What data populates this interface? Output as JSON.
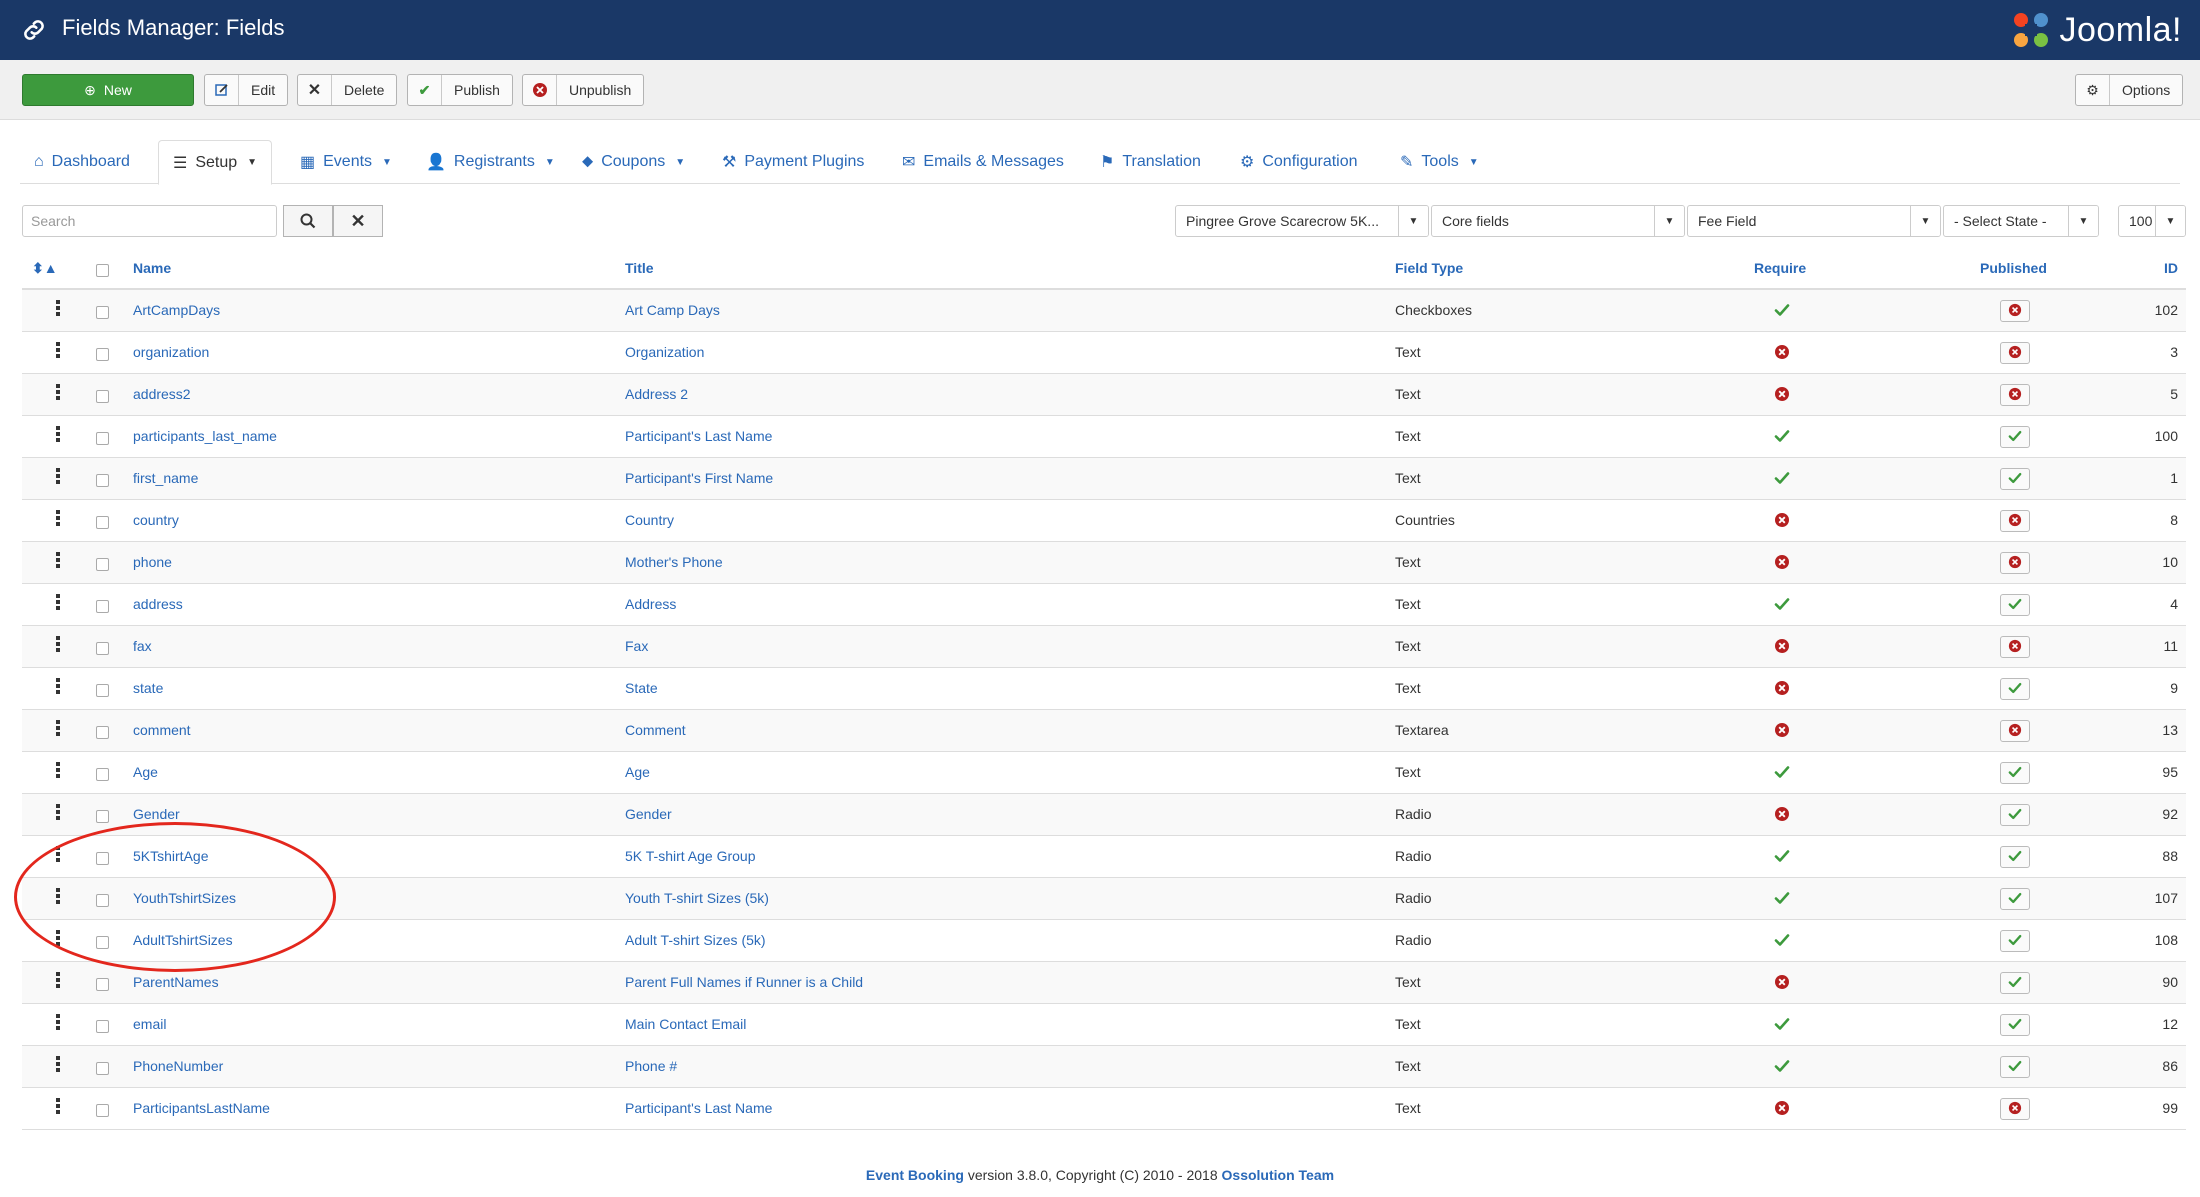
{
  "header": {
    "title": "Fields Manager: Fields",
    "brand": "Joomla!"
  },
  "toolbar": {
    "new": "New",
    "edit": "Edit",
    "delete": "Delete",
    "publish": "Publish",
    "unpublish": "Unpublish",
    "options": "Options"
  },
  "nav": [
    {
      "label": "Dashboard",
      "icon": "home-icon",
      "dropdown": false
    },
    {
      "label": "Setup",
      "icon": "list-icon",
      "dropdown": true,
      "active": true
    },
    {
      "label": "Events",
      "icon": "calendar-icon",
      "dropdown": true
    },
    {
      "label": "Registrants",
      "icon": "user-icon",
      "dropdown": true
    },
    {
      "label": "Coupons",
      "icon": "tag-icon",
      "dropdown": true
    },
    {
      "label": "Payment Plugins",
      "icon": "wrench-icon",
      "dropdown": false
    },
    {
      "label": "Emails & Messages",
      "icon": "mail-icon",
      "dropdown": false
    },
    {
      "label": "Translation",
      "icon": "flag-icon",
      "dropdown": false
    },
    {
      "label": "Configuration",
      "icon": "gear-icon",
      "dropdown": false
    },
    {
      "label": "Tools",
      "icon": "tools-icon",
      "dropdown": true
    }
  ],
  "filters": {
    "search_placeholder": "Search",
    "event": "Pingree Grove Scarecrow 5K...",
    "category": "Core fields",
    "fee": "Fee Field",
    "state": "- Select State -",
    "limit": "100"
  },
  "table": {
    "headers": {
      "name": "Name",
      "title": "Title",
      "type": "Field Type",
      "require": "Require",
      "published": "Published",
      "id": "ID"
    },
    "rows": [
      {
        "name": "ArtCampDays",
        "title": "Art Camp Days",
        "type": "Checkboxes",
        "require": true,
        "published": false,
        "id": "102"
      },
      {
        "name": "organization",
        "title": "Organization",
        "type": "Text",
        "require": false,
        "published": false,
        "id": "3"
      },
      {
        "name": "address2",
        "title": "Address 2",
        "type": "Text",
        "require": false,
        "published": false,
        "id": "5"
      },
      {
        "name": "participants_last_name",
        "title": "Participant's Last Name",
        "type": "Text",
        "require": true,
        "published": true,
        "id": "100"
      },
      {
        "name": "first_name",
        "title": "Participant's First Name",
        "type": "Text",
        "require": true,
        "published": true,
        "id": "1"
      },
      {
        "name": "country",
        "title": "Country",
        "type": "Countries",
        "require": false,
        "published": false,
        "id": "8"
      },
      {
        "name": "phone",
        "title": "Mother's Phone",
        "type": "Text",
        "require": false,
        "published": false,
        "id": "10"
      },
      {
        "name": "address",
        "title": "Address",
        "type": "Text",
        "require": true,
        "published": true,
        "id": "4"
      },
      {
        "name": "fax",
        "title": "Fax",
        "type": "Text",
        "require": false,
        "published": false,
        "id": "11"
      },
      {
        "name": "state",
        "title": "State",
        "type": "Text",
        "require": false,
        "published": true,
        "id": "9"
      },
      {
        "name": "comment",
        "title": "Comment",
        "type": "Textarea",
        "require": false,
        "published": false,
        "id": "13"
      },
      {
        "name": "Age",
        "title": "Age",
        "type": "Text",
        "require": true,
        "published": true,
        "id": "95"
      },
      {
        "name": "Gender",
        "title": "Gender",
        "type": "Radio",
        "require": false,
        "published": true,
        "id": "92"
      },
      {
        "name": "5KTshirtAge",
        "title": "5K T-shirt Age Group",
        "type": "Radio",
        "require": true,
        "published": true,
        "id": "88"
      },
      {
        "name": "YouthTshirtSizes",
        "title": "Youth T-shirt Sizes (5k)",
        "type": "Radio",
        "require": true,
        "published": true,
        "id": "107"
      },
      {
        "name": "AdultTshirtSizes",
        "title": "Adult T-shirt Sizes (5k)",
        "type": "Radio",
        "require": true,
        "published": true,
        "id": "108"
      },
      {
        "name": "ParentNames",
        "title": "Parent Full Names if Runner is a Child",
        "type": "Text",
        "require": false,
        "published": true,
        "id": "90"
      },
      {
        "name": "email",
        "title": "Main Contact Email",
        "type": "Text",
        "require": true,
        "published": true,
        "id": "12"
      },
      {
        "name": "PhoneNumber",
        "title": "Phone #",
        "type": "Text",
        "require": true,
        "published": true,
        "id": "86"
      },
      {
        "name": "ParticipantsLastName",
        "title": "Participant's Last Name",
        "type": "Text",
        "require": false,
        "published": false,
        "id": "99"
      }
    ]
  },
  "footer": {
    "product": "Event Booking",
    "text": " version 3.8.0, Copyright (C) 2010 - 2018 ",
    "company": "Ossolution Team"
  },
  "colors": {
    "header": "#1a3867",
    "link": "#2a69b8",
    "success": "#3d9a3d",
    "danger": "#b52020",
    "annotation": "#e3271d"
  }
}
